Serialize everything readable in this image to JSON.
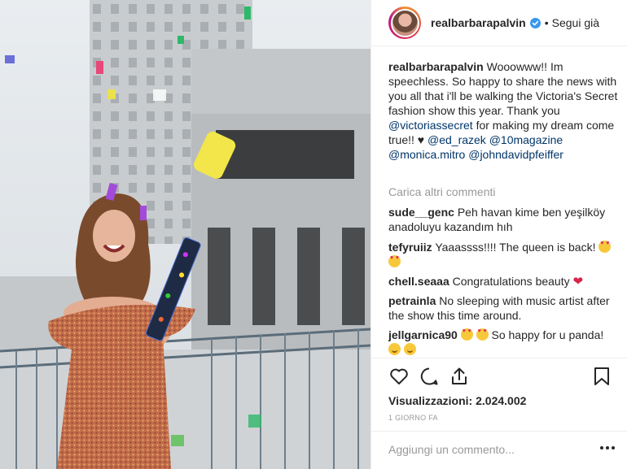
{
  "post": {
    "photo_alt": "",
    "author": "realbarbarapalvin",
    "verified": true,
    "separator": "•",
    "follow_label": "Segui già"
  },
  "caption": {
    "username": "realbarbarapalvin",
    "text_1": "Wooowww!! Im speechless. So happy to share the news with you all that i'll be walking the Victoria's Secret fashion show this year. Thank you ",
    "mention_1": "@victoriassecret",
    "text_2": " for making my dream come true!! ♥ ",
    "mention_2": "@ed_razek",
    "mention_3": "@10magazine",
    "mention_4": "@monica.mitro",
    "mention_5": "@johndavidpfeiffer"
  },
  "load_more": "Carica altri commenti",
  "comments": [
    {
      "username": "sude__genc",
      "text": "Peh havan kime ben yeşilköy anadoluyu kazandım hıh"
    },
    {
      "username": "tefyruiiz",
      "text": "Yaaassss!!!! The queen is back!"
    },
    {
      "username": "chell.seaaa",
      "text": "Congratulations beauty"
    },
    {
      "username": "petrainla",
      "text": "No sleeping with music artist after the show this time around."
    },
    {
      "username": "jellgarnica90",
      "text": "So happy for u panda!"
    }
  ],
  "icons": {
    "like": "heart-outline-icon",
    "comment": "comment-bubble-icon",
    "share": "share-upload-icon",
    "save": "bookmark-icon",
    "more": "ellipsis-icon"
  },
  "stats": {
    "views_label": "Visualizzazioni:",
    "views_value": "2.024.002",
    "time_ago": "1 GIORNO FA"
  },
  "add_comment": {
    "placeholder": "Aggiungi un commento..."
  },
  "colors": {
    "text": "#262626",
    "muted": "#999999",
    "link": "#003569",
    "verified_blue": "#3897f0",
    "border": "#efefef"
  }
}
